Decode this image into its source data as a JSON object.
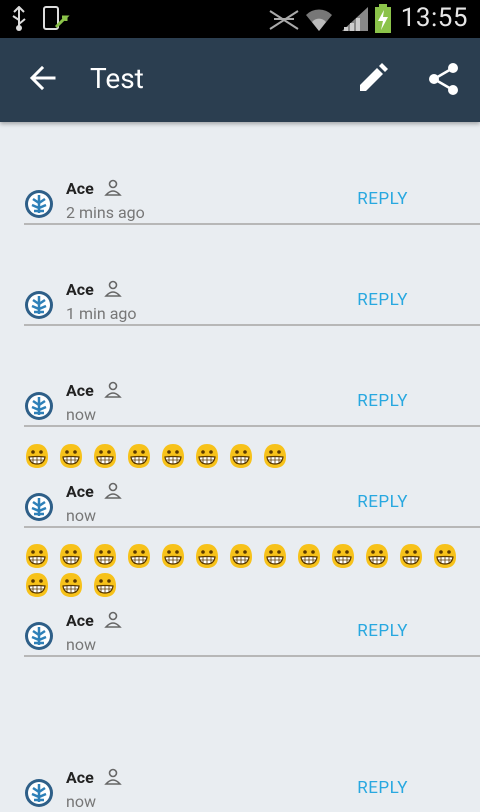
{
  "status_bar": {
    "time": "13:55"
  },
  "app_bar": {
    "title": "Test"
  },
  "comments": [
    {
      "name": "Ace",
      "time": "2 mins ago",
      "reply": "REPLY"
    },
    {
      "name": "Ace",
      "time": "1 min ago",
      "reply": "REPLY"
    },
    {
      "name": "Ace",
      "time": "now",
      "reply": "REPLY"
    },
    {
      "name": "Ace",
      "time": "now",
      "reply": "REPLY"
    },
    {
      "name": "Ace",
      "time": "now",
      "reply": "REPLY"
    },
    {
      "name": "Ace",
      "time": "now",
      "reply": "REPLY"
    }
  ],
  "emoji_rows": [
    {
      "emoji": "grinning-face",
      "count": 8
    },
    {
      "emoji": "grinning-face",
      "count": 13
    },
    {
      "emoji": "grinning-face",
      "count": 3
    }
  ],
  "icons": {
    "back": "arrow-back-icon",
    "edit": "pencil-icon",
    "share": "share-icon",
    "person": "person-icon",
    "avatar": "avatar-tree-icon"
  },
  "colors": {
    "app_bar": "#2b3e50",
    "reply": "#28a8e0",
    "background": "#e9edf1",
    "battery": "#8bc34a"
  }
}
